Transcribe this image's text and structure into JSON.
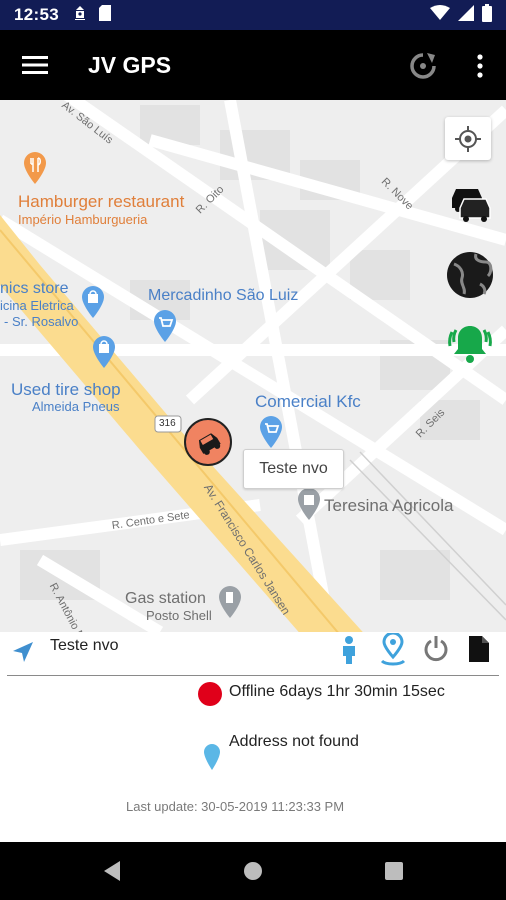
{
  "status_bar": {
    "time": "12:53"
  },
  "app_bar": {
    "title": "JV GPS",
    "menu_icon": "menu-icon",
    "refresh_icon": "refresh-icon",
    "more_icon": "more-vert-icon"
  },
  "map": {
    "pois": {
      "hamburger_name": "Hamburger restaurant",
      "hamburger_sub": "Império Hamburgueria",
      "electronics_name": "nics store",
      "electronics_sub1": "icina Eletrica",
      "electronics_sub2": "- Sr. Rosalvo",
      "mercadinho": "Mercadinho São Luiz",
      "used_tire_name": "Used tire shop",
      "used_tire_sub": "Almeida Pneus",
      "comercial": "Comercial Kfc",
      "teresina": "Teresina Agricola",
      "gas_name": "Gas station",
      "gas_sub": "Posto Shell"
    },
    "streets": {
      "sao_luis": "Av. São Luís",
      "otto": "R. Oito",
      "nove": "R. Nove",
      "seis": "R. Seis",
      "cento_sete": "R. Cento e Sete",
      "francisco": "Av. Francisco Carlos Jansen",
      "antonio": "R. Antônio M",
      "road_shield": "316"
    },
    "vehicle_label": "Teste nvo"
  },
  "panel": {
    "device_name": "Teste nvo",
    "status_text": "Offline 6days 1hr 30min 15sec",
    "status_color": "#e0001a",
    "address": "Address not found",
    "last_update": "Last update: 30-05-2019 11:23:33 PM"
  }
}
